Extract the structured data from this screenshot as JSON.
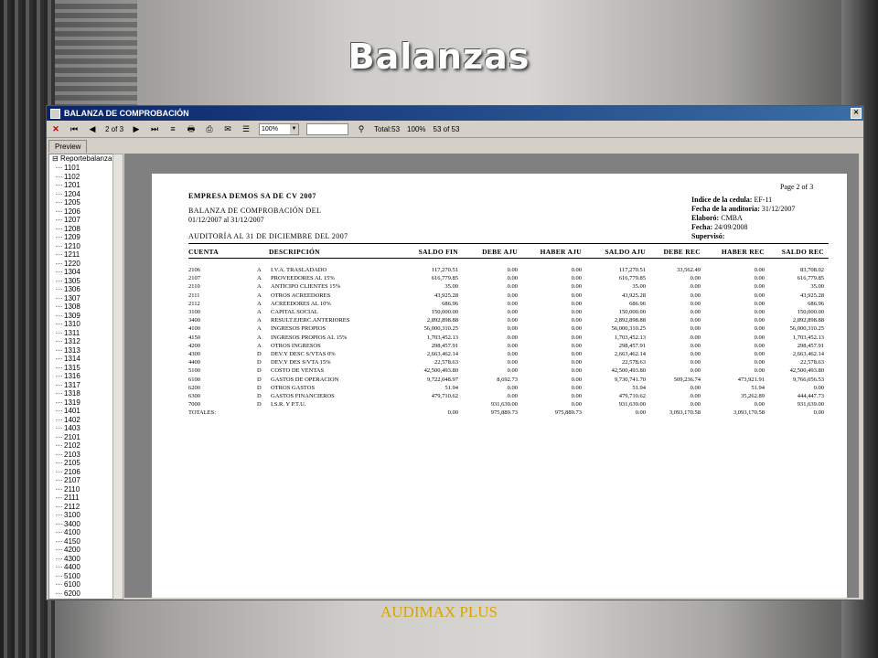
{
  "slide_title": "Balanzas",
  "footer": "AUDIMAX PLUS",
  "window": {
    "title": "BALANZA DE COMPROBACIÓN",
    "toolbar": {
      "page_indicator": "2 of 3",
      "zoom": "100%",
      "total": "Total:53",
      "pct": "100%",
      "records": "53 of 53"
    },
    "tab": "Preview"
  },
  "tree": {
    "root": "Reportebalanza",
    "items": [
      "1101",
      "1102",
      "1201",
      "1204",
      "1205",
      "1206",
      "1207",
      "1208",
      "1209",
      "1210",
      "1211",
      "1220",
      "1304",
      "1305",
      "1306",
      "1307",
      "1308",
      "1309",
      "1310",
      "1311",
      "1312",
      "1313",
      "1314",
      "1315",
      "1316",
      "1317",
      "1318",
      "1319",
      "1401",
      "1402",
      "1403",
      "2101",
      "2102",
      "2103",
      "2105",
      "2106",
      "2107",
      "2110",
      "2111",
      "2112",
      "3100",
      "3400",
      "4100",
      "4150",
      "4200",
      "4300",
      "4400",
      "5100",
      "6100",
      "6200"
    ]
  },
  "report": {
    "page_label": "Page 2 of 3",
    "company": "EMPRESA DEMOS SA DE CV 2007",
    "title": "BALANZA DE COMPROBACIÓN DEL",
    "period": "01/12/2007 al 31/12/2007",
    "audit": "AUDITORÍA AL 31 DE DICIEMBRE DEL 2007",
    "meta": {
      "indice_label": "Indice de la cedula:",
      "indice_value": "EF-11",
      "fecha_aud_label": "Fecha de la auditoria:",
      "fecha_aud_value": "31/12/2007",
      "elaboro_label": "Elaboró:",
      "elaboro_value": "CMBA",
      "fecha_label": "Fecha:",
      "fecha_value": "24/09/2008",
      "superviso_label": "Supervisó:"
    },
    "headers": [
      "CUENTA",
      "DESCRIPCIÓN",
      "SALDO FIN",
      "DEBE AJU",
      "HABER AJU",
      "SALDO AJU",
      "DEBE REC",
      "HABER REC",
      "SALDO REC"
    ],
    "rows": [
      [
        "2106",
        "A",
        "I.V.A. TRASLADADO",
        "117,270.51",
        "0.00",
        "0.00",
        "117,270.51",
        "33,562.49",
        "0.00",
        "83,708.02"
      ],
      [
        "2107",
        "A",
        "PROVEEDORES AL 15%",
        "616,779.85",
        "0.00",
        "0.00",
        "616,779.85",
        "0.00",
        "0.00",
        "616,779.85"
      ],
      [
        "2110",
        "A",
        "ANTICIPO CLIENTES 15%",
        "35.00",
        "0.00",
        "0.00",
        "35.00",
        "0.00",
        "0.00",
        "35.00"
      ],
      [
        "2111",
        "A",
        "OTROS ACREEDORES",
        "43,925.28",
        "0.00",
        "0.00",
        "43,925.28",
        "0.00",
        "0.00",
        "43,925.28"
      ],
      [
        "2112",
        "A",
        "ACREEDORES AL 10%",
        "686.96",
        "0.00",
        "0.00",
        "686.96",
        "0.00",
        "0.00",
        "686.96"
      ],
      [
        "3100",
        "A",
        "CAPITAL SOCIAL",
        "150,000.00",
        "0.00",
        "0.00",
        "150,000.00",
        "0.00",
        "0.00",
        "150,000.00"
      ],
      [
        "3400",
        "A",
        "RESULT.EJERC.ANTERIORES",
        "2,892,898.88",
        "0.00",
        "0.00",
        "2,892,898.88",
        "0.00",
        "0.00",
        "2,892,898.88"
      ],
      [
        "4100",
        "A",
        "INGRESOS PROPIOS",
        "56,000,310.25",
        "0.00",
        "0.00",
        "56,000,310.25",
        "0.00",
        "0.00",
        "56,000,310.25"
      ],
      [
        "4150",
        "A",
        "INGRESOS PROPIOS AL 15%",
        "1,703,452.13",
        "0.00",
        "0.00",
        "1,703,452.13",
        "0.00",
        "0.00",
        "1,703,452.13"
      ],
      [
        "4200",
        "A",
        "OTROS INGRESOS",
        "298,457.91",
        "0.00",
        "0.00",
        "298,457.91",
        "0.00",
        "0.00",
        "298,457.91"
      ],
      [
        "4300",
        "D",
        "DEV.Y DESC S/VTAS 0%",
        "2,663,462.14",
        "0.00",
        "0.00",
        "2,663,462.14",
        "0.00",
        "0.00",
        "2,663,462.14"
      ],
      [
        "4400",
        "D",
        "DEV.Y DES S/VTA 15%",
        "22,578.63",
        "0.00",
        "0.00",
        "22,578.63",
        "0.00",
        "0.00",
        "22,578.63"
      ],
      [
        "5100",
        "D",
        "COSTO DE VENTAS",
        "42,500,493.80",
        "0.00",
        "0.00",
        "42,500,493.80",
        "0.00",
        "0.00",
        "42,500,493.80"
      ],
      [
        "6100",
        "D",
        "GASTOS DE OPERACION",
        "9,722,048.97",
        "8,692.73",
        "0.00",
        "9,730,741.70",
        "509,236.74",
        "473,921.91",
        "9,766,056.53"
      ],
      [
        "6200",
        "D",
        "OTROS GASTOS",
        "51.94",
        "0.00",
        "0.00",
        "51.94",
        "0.00",
        "51.94",
        "0.00"
      ],
      [
        "6300",
        "D",
        "GASTOS FINANCIEROS",
        "479,710.62",
        "0.00",
        "0.00",
        "479,710.62",
        "0.00",
        "35,262.89",
        "444,447.73"
      ],
      [
        "7000",
        "D",
        "I.S.R. Y P.T.U.",
        "",
        "931,639.00",
        "0.00",
        "931,639.00",
        "0.00",
        "0.00",
        "931,639.00"
      ]
    ],
    "totals": [
      "TOTALES:",
      "",
      "",
      "0.00",
      "975,889.73",
      "975,889.73",
      "0.00",
      "3,093,170.58",
      "3,093,170.58",
      "0.00"
    ]
  }
}
